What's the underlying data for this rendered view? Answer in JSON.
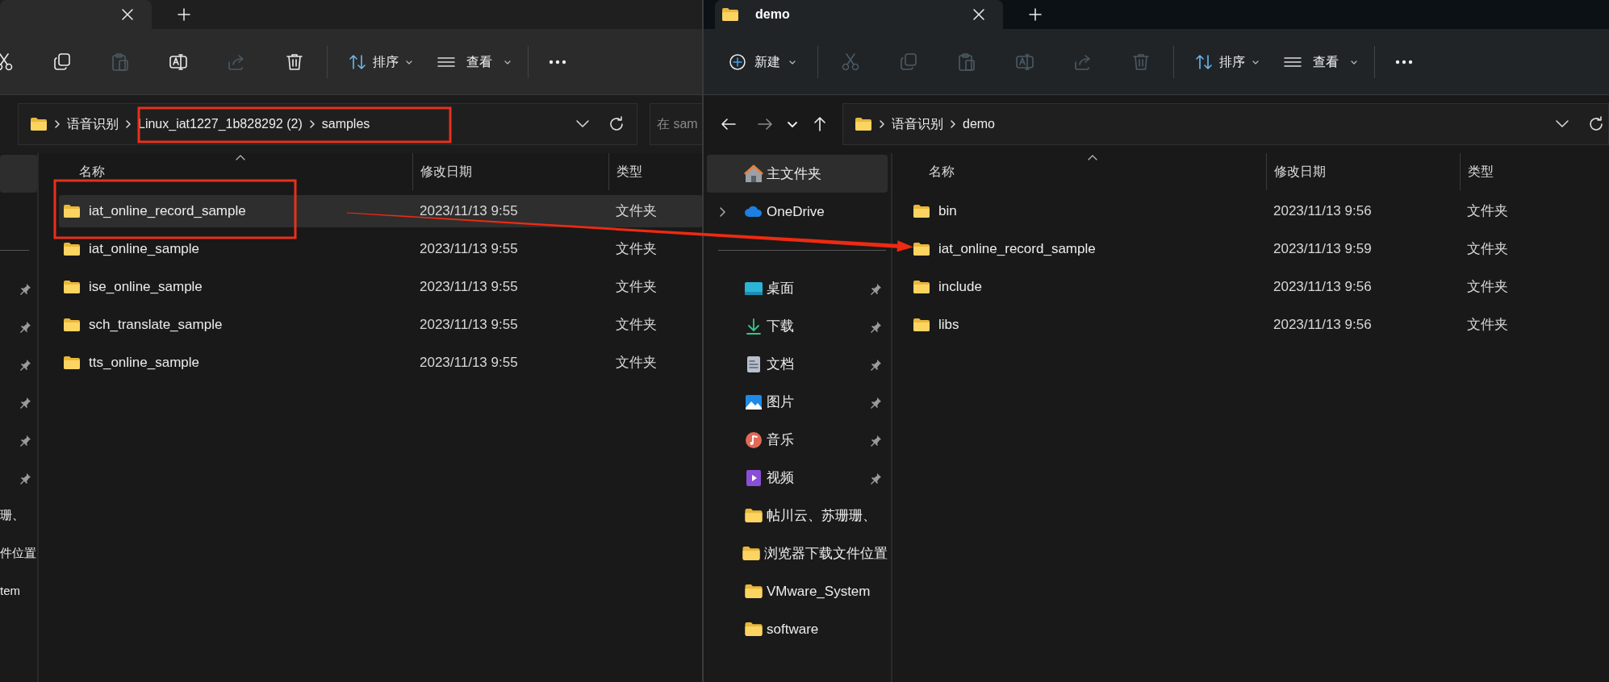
{
  "windows": [
    {
      "tab": {
        "selected": true
      },
      "toolbar": {
        "actions": [
          {
            "kind": "cut",
            "disabled": false
          },
          {
            "kind": "copy",
            "disabled": false
          },
          {
            "kind": "paste",
            "disabled": true
          },
          {
            "kind": "rename",
            "disabled": false
          },
          {
            "kind": "share",
            "disabled": true
          },
          {
            "kind": "delete",
            "disabled": false
          }
        ],
        "sort_label": "排序",
        "view_label": "查看"
      },
      "address": {
        "crumbs": [
          "语音识别",
          "Linux_iat1227_1b828292 (2)",
          "samples"
        ]
      },
      "search": {
        "placeholder": "在 sam"
      },
      "sidebar": {
        "items": [
          {
            "kind": "blank",
            "selected": true,
            "pinned": false
          },
          {
            "kind": "blank"
          },
          {
            "kind": "divider"
          },
          {
            "kind": "blank",
            "selected": false,
            "pinned": true
          },
          {
            "kind": "blank",
            "selected": false,
            "pinned": true
          },
          {
            "kind": "blank",
            "selected": false,
            "pinned": true
          },
          {
            "kind": "blank",
            "selected": false,
            "pinned": true
          },
          {
            "kind": "blank",
            "selected": false,
            "pinned": true
          },
          {
            "kind": "blank",
            "selected": false,
            "pinned": true
          },
          {
            "kind": "text",
            "label": "珊、",
            "selected": false
          },
          {
            "kind": "text",
            "label": "件位置",
            "selected": false
          },
          {
            "kind": "text",
            "label": "tem",
            "selected": false
          }
        ]
      },
      "columns": [
        {
          "label": "名称",
          "sorted": true
        },
        {
          "label": "修改日期",
          "sorted": false
        },
        {
          "label": "类型",
          "sorted": false
        }
      ],
      "files": [
        {
          "name": "iat_online_record_sample",
          "modified": "2023/11/13 9:55",
          "type": "文件夹",
          "selected": true
        },
        {
          "name": "iat_online_sample",
          "modified": "2023/11/13 9:55",
          "type": "文件夹",
          "selected": false
        },
        {
          "name": "ise_online_sample",
          "modified": "2023/11/13 9:55",
          "type": "文件夹",
          "selected": false
        },
        {
          "name": "sch_translate_sample",
          "modified": "2023/11/13 9:55",
          "type": "文件夹",
          "selected": false
        },
        {
          "name": "tts_online_sample",
          "modified": "2023/11/13 9:55",
          "type": "文件夹",
          "selected": false
        }
      ]
    },
    {
      "tab": {
        "title": "demo",
        "selected": true
      },
      "toolbar": {
        "new_label": "新建",
        "actions": [
          {
            "kind": "cut",
            "disabled": true
          },
          {
            "kind": "copy",
            "disabled": true
          },
          {
            "kind": "paste",
            "disabled": true
          },
          {
            "kind": "rename",
            "disabled": true
          },
          {
            "kind": "share",
            "disabled": true
          },
          {
            "kind": "delete",
            "disabled": true
          }
        ],
        "sort_label": "排序",
        "view_label": "查看"
      },
      "address": {
        "crumbs": [
          "语音识别",
          "demo"
        ]
      },
      "sidebar": {
        "items": [
          {
            "kind": "home",
            "label": "主文件夹",
            "selected": true,
            "pinned": false
          },
          {
            "kind": "cloud",
            "label": "OneDrive",
            "selected": false,
            "pinned": false,
            "expanded": false
          },
          {
            "kind": "divider"
          },
          {
            "kind": "desktop",
            "label": "桌面",
            "selected": false,
            "pinned": true
          },
          {
            "kind": "download",
            "label": "下载",
            "selected": false,
            "pinned": true
          },
          {
            "kind": "docs",
            "label": "文档",
            "selected": false,
            "pinned": true
          },
          {
            "kind": "pictures",
            "label": "图片",
            "selected": false,
            "pinned": true
          },
          {
            "kind": "music",
            "label": "音乐",
            "selected": false,
            "pinned": true
          },
          {
            "kind": "video",
            "label": "视频",
            "selected": false,
            "pinned": true
          },
          {
            "kind": "folder",
            "label": "帖川云、苏珊珊、",
            "selected": false,
            "pinned": false
          },
          {
            "kind": "folder",
            "label": "浏览器下载文件位置",
            "selected": false,
            "pinned": false
          },
          {
            "kind": "folder",
            "label": "VMware_System",
            "selected": false,
            "pinned": false
          },
          {
            "kind": "folder",
            "label": "software",
            "selected": false,
            "pinned": false
          }
        ]
      },
      "columns": [
        {
          "label": "名称",
          "sorted": true
        },
        {
          "label": "修改日期",
          "sorted": false
        },
        {
          "label": "类型",
          "sorted": false
        }
      ],
      "files": [
        {
          "name": "bin",
          "modified": "2023/11/13 9:56",
          "type": "文件夹",
          "selected": false
        },
        {
          "name": "iat_online_record_sample",
          "modified": "2023/11/13 9:59",
          "type": "文件夹",
          "selected": false
        },
        {
          "name": "include",
          "modified": "2023/11/13 9:56",
          "type": "文件夹",
          "selected": false
        },
        {
          "name": "libs",
          "modified": "2023/11/13 9:56",
          "type": "文件夹",
          "selected": false
        }
      ]
    }
  ]
}
